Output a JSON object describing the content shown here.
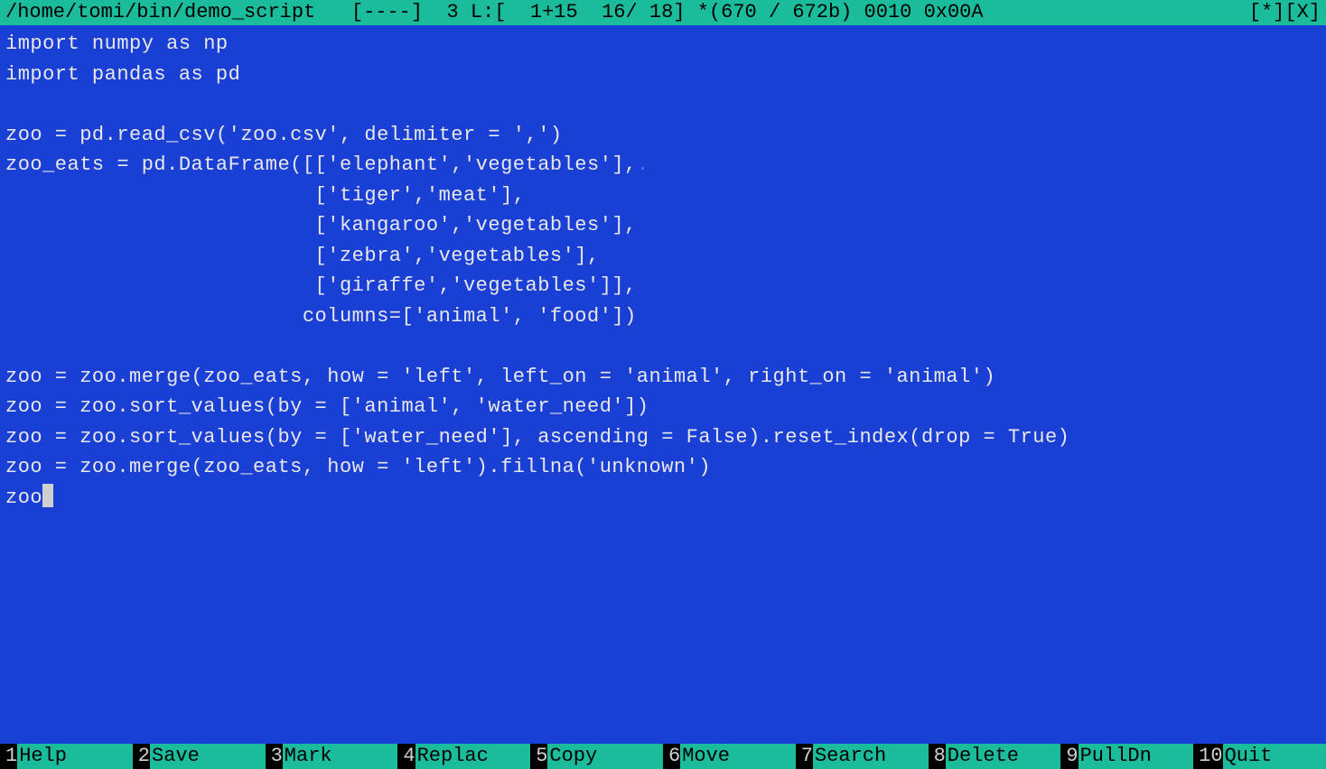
{
  "titlebar": {
    "left": "/home/tomi/bin/demo_script   [----]  3 L:[  1+15  16/ 18] *(670 / 672b) 0010 0x00A",
    "right": "[*][X]"
  },
  "code_lines": [
    "import numpy as np",
    "import pandas as pd",
    "",
    "zoo = pd.read_csv('zoo.csv', delimiter = ',')",
    "zoo_eats = pd.DataFrame([['elephant','vegetables'],",
    "                         ['tiger','meat'],",
    "                         ['kangaroo','vegetables'],",
    "                         ['zebra','vegetables'],",
    "                         ['giraffe','vegetables']],",
    "                        columns=['animal', 'food'])",
    "",
    "zoo = zoo.merge(zoo_eats, how = 'left', left_on = 'animal', right_on = 'animal')",
    "zoo = zoo.sort_values(by = ['animal', 'water_need'])",
    "zoo = zoo.sort_values(by = ['water_need'], ascending = False).reset_index(drop = True)",
    "zoo = zoo.merge(zoo_eats, how = 'left').fillna('unknown')",
    "zoo"
  ],
  "line_end_marker_on_line": 4,
  "cursor_after_last": true,
  "fkeys": [
    {
      "num": "1",
      "label": "Help"
    },
    {
      "num": "2",
      "label": "Save"
    },
    {
      "num": "3",
      "label": "Mark"
    },
    {
      "num": "4",
      "label": "Replac"
    },
    {
      "num": "5",
      "label": "Copy"
    },
    {
      "num": "6",
      "label": "Move"
    },
    {
      "num": "7",
      "label": "Search"
    },
    {
      "num": "8",
      "label": "Delete"
    },
    {
      "num": "9",
      "label": "PullDn"
    },
    {
      "num": "10",
      "label": "Quit"
    }
  ]
}
